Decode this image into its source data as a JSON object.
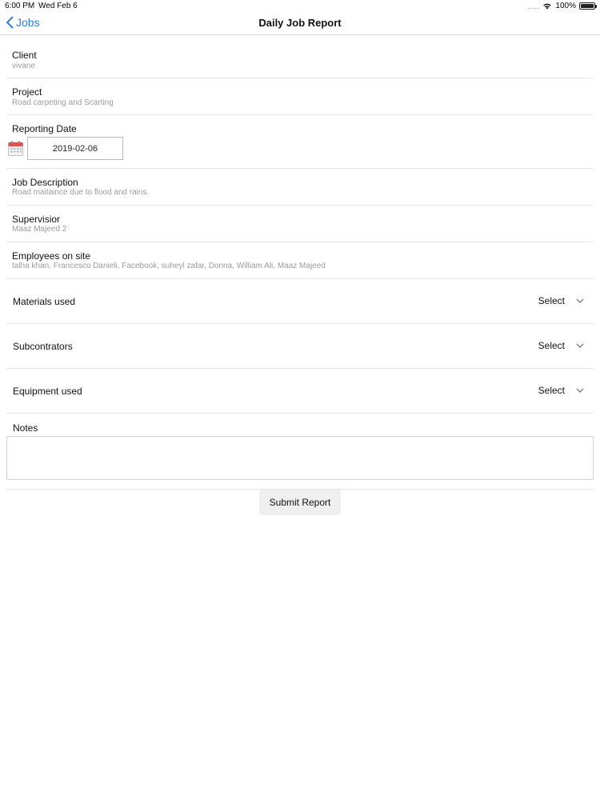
{
  "status_bar": {
    "time": "6:00 PM",
    "date": "Wed Feb 6",
    "signal": "....",
    "battery": "100%"
  },
  "nav": {
    "back_label": "Jobs",
    "title": "Daily Job Report"
  },
  "fields": {
    "client": {
      "label": "Client",
      "value": "vivane"
    },
    "project": {
      "label": "Project",
      "value": "Road carpeting and Scarting"
    },
    "reporting_date": {
      "label": "Reporting Date",
      "value": "2019-02-06"
    },
    "job_description": {
      "label": "Job Description",
      "value": "Road maitaince due to flood and rains."
    },
    "supervisor": {
      "label": "Supervisior",
      "value": "Maaz Majeed 2"
    },
    "employees": {
      "label": "Employees on site",
      "value": "talha khan, Francesco Danieli, Facebook, suheyl zafar, Donna, William Ali, Maaz Majeed"
    }
  },
  "selects": {
    "materials": {
      "label": "Materials used",
      "value": "Select"
    },
    "subcontractors": {
      "label": "Subcontrators",
      "value": "Select"
    },
    "equipment": {
      "label": "Equipment used",
      "value": "Select"
    }
  },
  "notes": {
    "label": "Notes",
    "value": ""
  },
  "submit_label": "Submit Report",
  "colors": {
    "accent": "#2a7be4",
    "muted_text": "#9a9a9a",
    "divider": "#e6e6e6",
    "button_bg": "#efefef"
  }
}
